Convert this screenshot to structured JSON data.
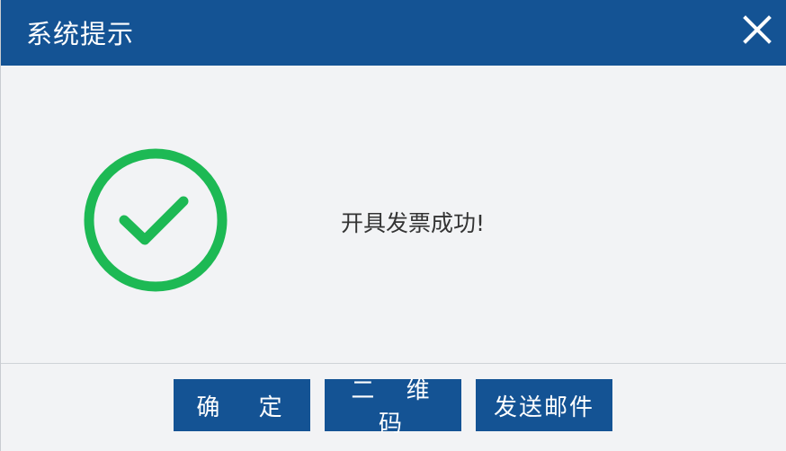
{
  "dialog": {
    "title": "系统提示",
    "close_icon": "close-icon",
    "message": "开具发票成功!",
    "status_icon": "success-check-icon",
    "colors": {
      "header": "#145394",
      "success": "#1db954",
      "button": "#145394"
    }
  },
  "buttons": {
    "ok": "确 定",
    "qrcode": "二 维 码",
    "send_email": "发送邮件"
  }
}
